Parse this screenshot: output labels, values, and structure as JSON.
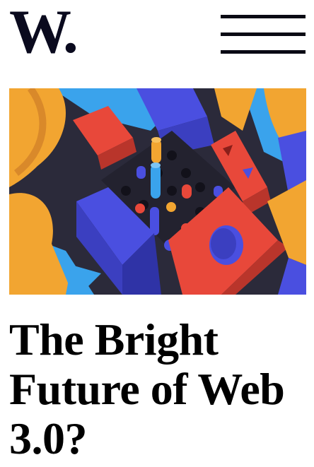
{
  "header": {
    "logo_text": "W.",
    "menu_icon": "hamburger-menu-icon"
  },
  "hero": {
    "image_subject": "colorful 3D geometric blocks and pegs",
    "colors": [
      "#f2a531",
      "#e8483a",
      "#4a4fe0",
      "#3aa3ec",
      "#2b2a3a"
    ]
  },
  "article": {
    "title": "The Bright Future of Web 3.0?"
  }
}
